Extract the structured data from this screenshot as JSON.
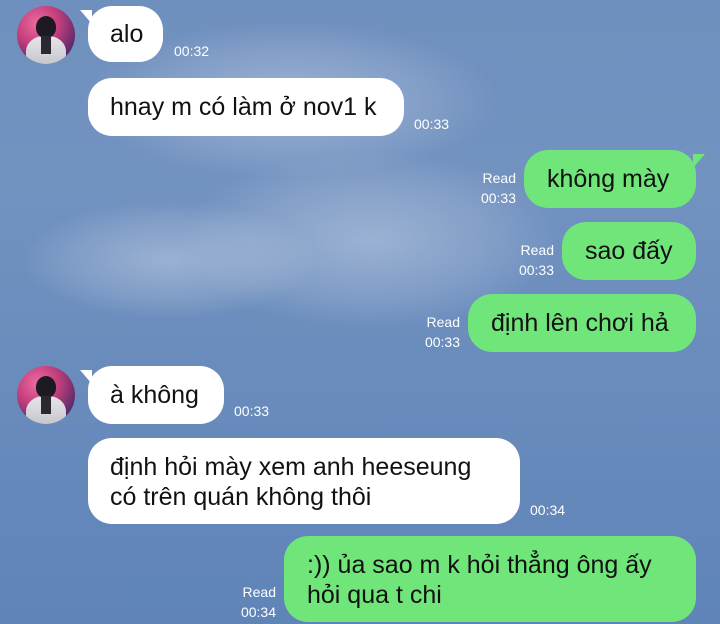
{
  "chat": {
    "contact_avatar": "avatar",
    "messages": [
      {
        "direction": "incoming",
        "lines": [
          "alo"
        ],
        "time": "00:32",
        "status": ""
      },
      {
        "direction": "incoming",
        "lines": [
          "hnay m có làm ở nov1 k"
        ],
        "time": "00:33",
        "status": ""
      },
      {
        "direction": "outgoing",
        "lines": [
          "không mày"
        ],
        "time": "00:33",
        "status": "Read"
      },
      {
        "direction": "outgoing",
        "lines": [
          "sao đấy"
        ],
        "time": "00:33",
        "status": "Read"
      },
      {
        "direction": "outgoing",
        "lines": [
          "định lên chơi hả"
        ],
        "time": "00:33",
        "status": "Read"
      },
      {
        "direction": "incoming",
        "lines": [
          "à không"
        ],
        "time": "00:33",
        "status": ""
      },
      {
        "direction": "incoming",
        "lines": [
          "định hỏi mày xem anh heeseung",
          "có trên quán không thôi"
        ],
        "time": "00:34",
        "status": ""
      },
      {
        "direction": "outgoing",
        "lines": [
          ":)) ủa sao m k hỏi thẳng ông ấy",
          "hỏi qua t chi"
        ],
        "time": "00:34",
        "status": "Read"
      }
    ]
  },
  "colors": {
    "background": "#6f8fbe",
    "incoming_bubble": "#ffffff",
    "outgoing_bubble": "#6fe57a",
    "meta_text": "#ffffff"
  }
}
